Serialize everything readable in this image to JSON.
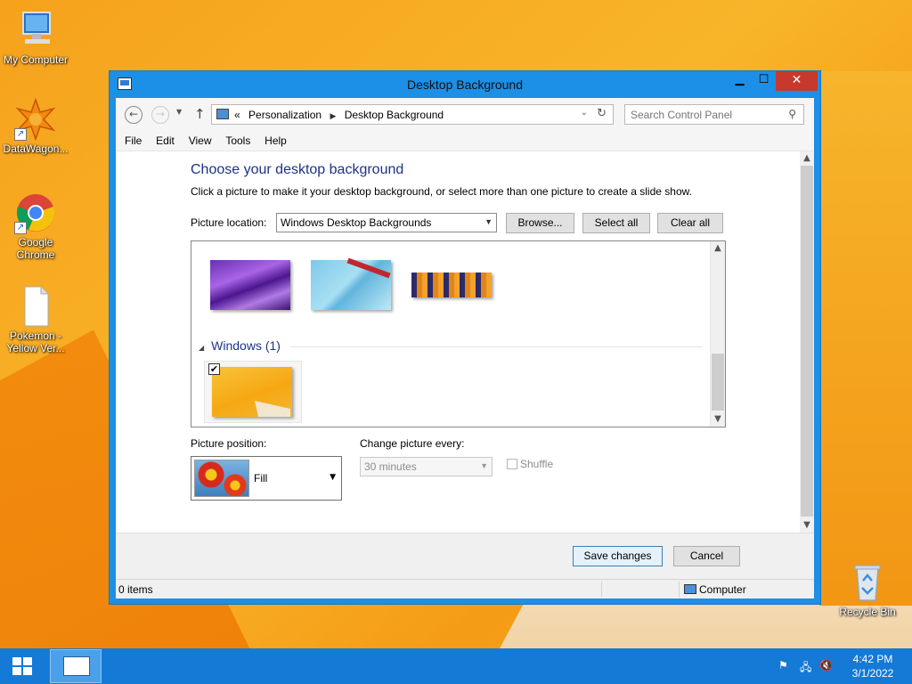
{
  "desktop": {
    "icons": [
      {
        "label": "My Computer"
      },
      {
        "label": "DataWagon..."
      },
      {
        "label": "Google Chrome"
      },
      {
        "label": "Pokemon - Yellow Ver..."
      },
      {
        "label": "Recycle Bin"
      }
    ]
  },
  "window": {
    "title": "Desktop Background",
    "buttons": {
      "minimize": "▁",
      "maximize": "☐",
      "close": "✕"
    }
  },
  "address": {
    "prefix": "«",
    "crumbs": [
      "Personalization",
      "Desktop Background"
    ],
    "search_placeholder": "Search Control Panel"
  },
  "menu": [
    "File",
    "Edit",
    "View",
    "Tools",
    "Help"
  ],
  "content": {
    "heading": "Choose your desktop background",
    "subtext": "Click a picture to make it your desktop background, or select more than one picture to create a slide show.",
    "picture_location_label": "Picture location:",
    "picture_location_value": "Windows Desktop Backgrounds",
    "browse_label": "Browse...",
    "select_all_label": "Select all",
    "clear_all_label": "Clear all",
    "group_label": "Windows (1)",
    "selected_checkmark": "✔",
    "picture_position_label": "Picture position:",
    "picture_position_value": "Fill",
    "change_every_label": "Change picture every:",
    "change_every_value": "30 minutes",
    "shuffle_label": "Shuffle"
  },
  "footer": {
    "save_label": "Save changes",
    "cancel_label": "Cancel"
  },
  "status": {
    "items": "0 items",
    "location": "Computer"
  },
  "taskbar": {
    "time": "4:42 PM",
    "date": "3/1/2022"
  },
  "colors": {
    "accent": "#1c8fe6",
    "heading": "#1e3287",
    "close": "#c7392c",
    "taskbar": "#1579d6"
  }
}
